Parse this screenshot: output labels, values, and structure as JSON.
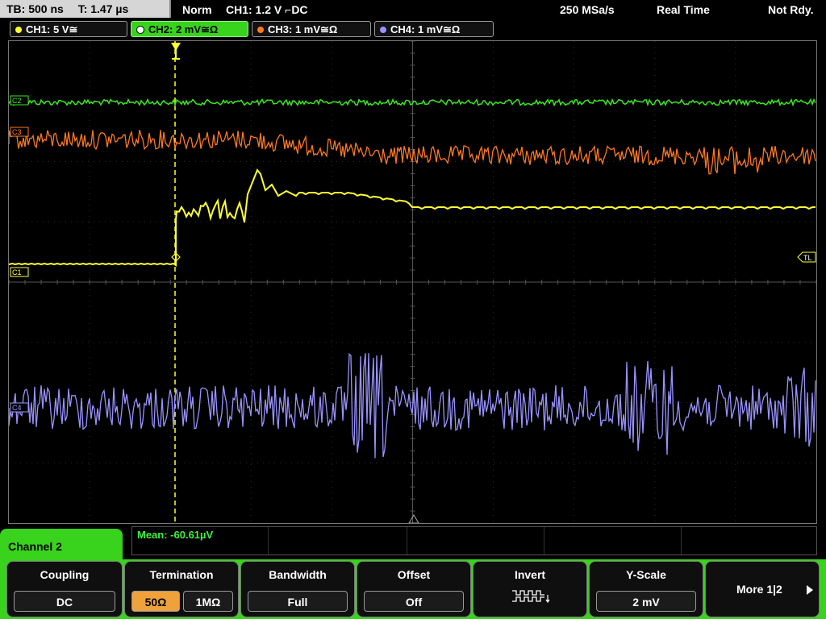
{
  "status": {
    "timebase": "TB: 500 ns",
    "trigger_time": "T: 1.47 µs",
    "mode": "Norm",
    "trigger_info": "CH1: 1.2 V ⌐DC",
    "sample_rate": "250 MSa/s",
    "acq_mode": "Real Time",
    "state": "Not Rdy."
  },
  "channels": [
    {
      "label": "CH1: 5 V≅",
      "color": "#ffff33"
    },
    {
      "label": "CH2: 2 mV≅Ω",
      "color": "#39d21d",
      "active": true
    },
    {
      "label": "CH3: 1 mV≅Ω",
      "color": "#ff7a1f"
    },
    {
      "label": "CH4: 1 mV≅Ω",
      "color": "#9a93ff"
    }
  ],
  "markers": {
    "c2": "C2",
    "c3": "C3",
    "c1": "C1",
    "c4": "C4",
    "tl": "TL"
  },
  "measurement": {
    "mean": "Mean: -60.61µV"
  },
  "panel": {
    "title": "Channel 2"
  },
  "softkeys": {
    "coupling": {
      "title": "Coupling",
      "value": "DC"
    },
    "termination": {
      "title": "Termination",
      "opt1": "50Ω",
      "opt2": "1MΩ"
    },
    "bandwidth": {
      "title": "Bandwidth",
      "value": "Full"
    },
    "offset": {
      "title": "Offset",
      "value": "Off"
    },
    "invert": {
      "title": "Invert"
    },
    "yscale": {
      "title": "Y-Scale",
      "value": "2 mV"
    },
    "more": {
      "label": "More 1|2"
    }
  }
}
